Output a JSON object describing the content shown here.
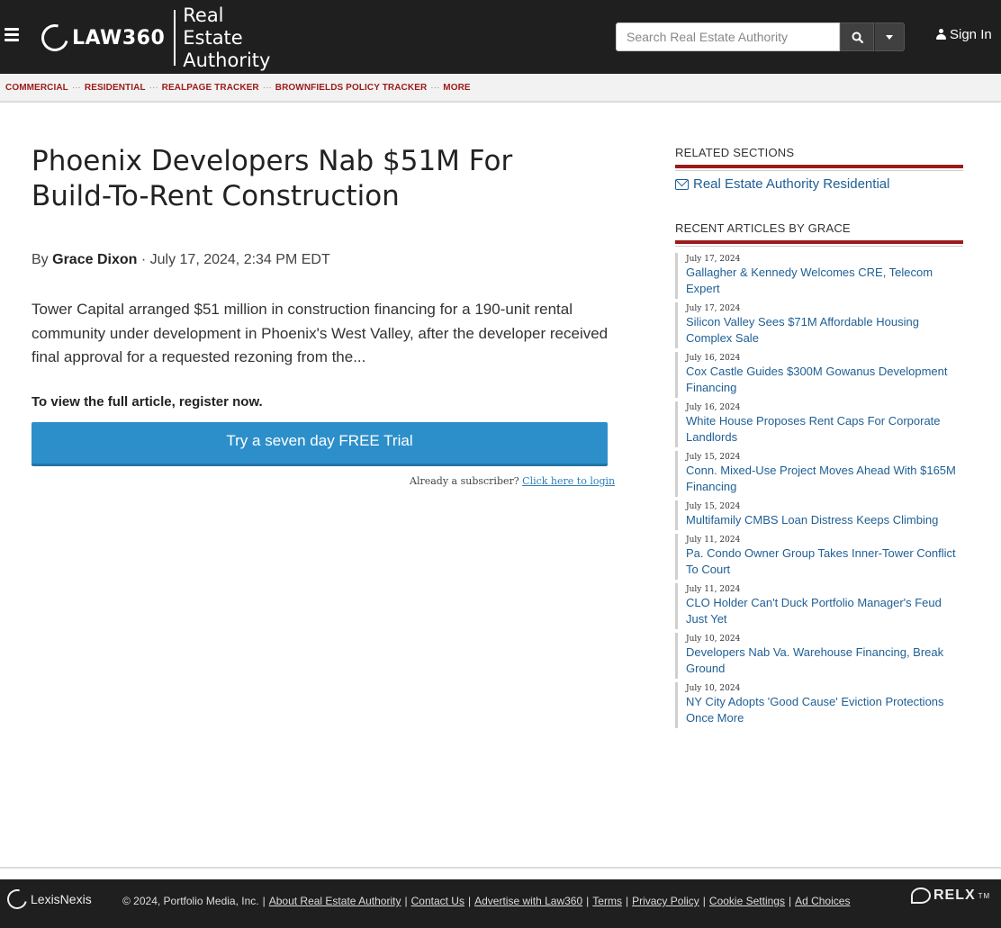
{
  "header": {
    "logo_brand": "LAW360",
    "logo_section": "Real Estate Authority",
    "search_placeholder": "Search Real Estate Authority",
    "signin_label": "Sign In"
  },
  "subnav": {
    "items": [
      "COMMERCIAL",
      "RESIDENTIAL",
      "REALPAGE TRACKER",
      "BROWNFIELDS POLICY TRACKER",
      "MORE"
    ],
    "separator": "···"
  },
  "article": {
    "title": "Phoenix Developers Nab $51M For Build-To-Rent Construction",
    "by": "By",
    "author": "Grace Dixon",
    "date": "· July 17, 2024, 2:34 PM EDT",
    "summary": "Tower Capital arranged $51 million in construction financing for a 190-unit rental community under development in Phoenix's West Valley, after the developer received final approval for a requested rezoning from the...",
    "cta_text": "To view the full article, register now.",
    "trial_button": "Try a seven day FREE Trial",
    "already_text": "Already a subscriber?",
    "login_link": "Click here to login"
  },
  "sidebar": {
    "related_heading": "RELATED SECTIONS",
    "related_link": "Real Estate Authority Residential",
    "recent_heading": "RECENT ARTICLES BY GRACE",
    "recent": [
      {
        "date": "July 17, 2024",
        "title": "Gallagher & Kennedy Welcomes CRE, Telecom Expert"
      },
      {
        "date": "July 17, 2024",
        "title": "Silicon Valley Sees $71M Affordable Housing Complex Sale"
      },
      {
        "date": "July 16, 2024",
        "title": "Cox Castle Guides $300M Gowanus Development Financing"
      },
      {
        "date": "July 16, 2024",
        "title": "White House Proposes Rent Caps For Corporate Landlords"
      },
      {
        "date": "July 15, 2024",
        "title": "Conn. Mixed-Use Project Moves Ahead With $165M Financing"
      },
      {
        "date": "July 15, 2024",
        "title": "Multifamily CMBS Loan Distress Keeps Climbing"
      },
      {
        "date": "July 11, 2024",
        "title": "Pa. Condo Owner Group Takes Inner-Tower Conflict To Court"
      },
      {
        "date": "July 11, 2024",
        "title": "CLO Holder Can't Duck Portfolio Manager's Feud Just Yet"
      },
      {
        "date": "July 10, 2024",
        "title": "Developers Nab Va. Warehouse Financing, Break Ground"
      },
      {
        "date": "July 10, 2024",
        "title": "NY City Adopts 'Good Cause' Eviction Protections Once More"
      }
    ]
  },
  "footer": {
    "lexis_label": "LexisNexis",
    "copyright": "© 2024, Portfolio Media, Inc.",
    "links": [
      "About Real Estate Authority",
      "Contact Us",
      "Advertise with Law360",
      "Terms",
      "Privacy Policy",
      "Cookie Settings",
      "Ad Choices"
    ],
    "relx_label": "RELX",
    "relx_tm": "TM"
  }
}
